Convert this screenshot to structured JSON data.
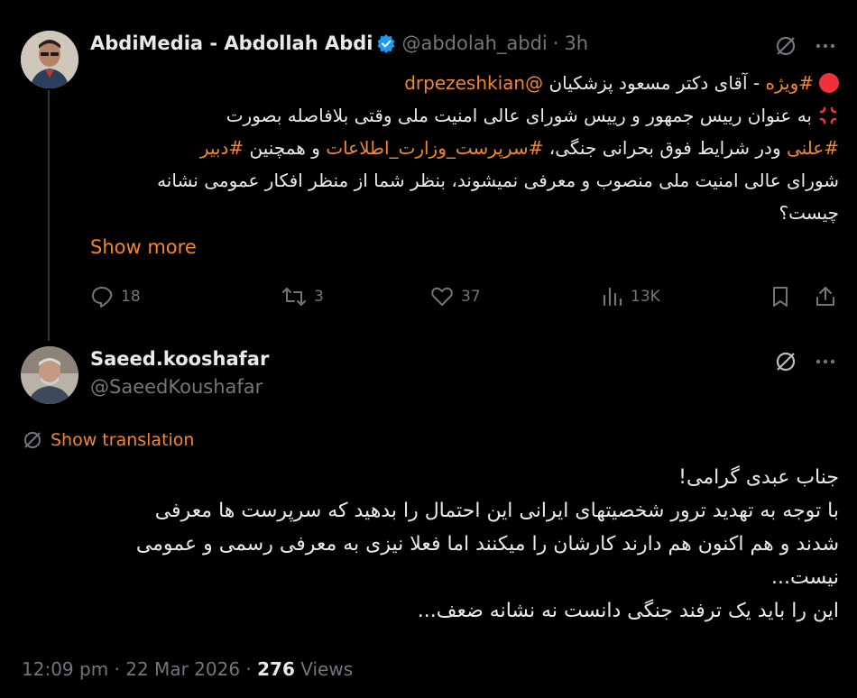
{
  "tweet1": {
    "author_name": "AbdiMedia - Abdollah Abdi",
    "handle": "@abdolah_abdi",
    "separator": "·",
    "time": "3h",
    "line1_mention": "@drpezeshkian",
    "line1_text": "آقای دکتر مسعود پزشکیان",
    "line1_tag": "#ویژه",
    "line1_dash": "-",
    "line2_text": "به عنوان رییس جمهور و رییس شورای عالی امنیت ملی وقتی بلافاصله بصورت",
    "line3_tag1": "#علنی",
    "line3_text1": "ودر شرایط فوق بحرانی جنگی،",
    "line3_tag2": "#سرپرست_وزارت_اطلاعات",
    "line3_text2": "و همچنین",
    "line3_tag3": "#دبیر",
    "line4_text": "شورای عالی امنیت ملی منصوب و معرفی نمیشوند، بنظر شما از منظر افکار عمومی نشانه",
    "line5_text": "چیست؟",
    "show_more": "Show more",
    "stats": {
      "replies": "18",
      "reposts": "3",
      "likes": "37",
      "views": "13K"
    }
  },
  "reply": {
    "author_name": "Saeed.kooshafar",
    "handle": "@SaeedKoushafar",
    "show_translation": "Show translation",
    "lines": [
      "جناب عبدی گرامی!",
      "با توجه به تهدید ترور شخصیتهای ایرانی این احتمال را بدهید که سرپرست ها معرفی",
      "شدند و هم اکنون هم دارند کارشان را میکنند اما فعلا نیزی به معرفی رسمی و عمومی",
      "نیست...",
      "این را باید یک ترفند جنگی دانست نه نشانه ضعف..."
    ],
    "time": "12:09 pm",
    "date": "22 Mar 2026",
    "views_count": "276",
    "views_label": "Views",
    "separator": "·"
  },
  "icons": {
    "grok": "grok-icon",
    "more": "more-icon",
    "reply": "reply-icon",
    "repost": "repost-icon",
    "like": "like-icon",
    "views": "views-icon",
    "bookmark": "bookmark-icon",
    "share": "share-icon",
    "verified": "verified-badge-icon",
    "translate": "translate-icon"
  },
  "colors": {
    "accent": "#f4862a",
    "muted": "#71767b",
    "text": "#e7e9ea",
    "background": "#000000",
    "verified": "#1d9bf0"
  }
}
